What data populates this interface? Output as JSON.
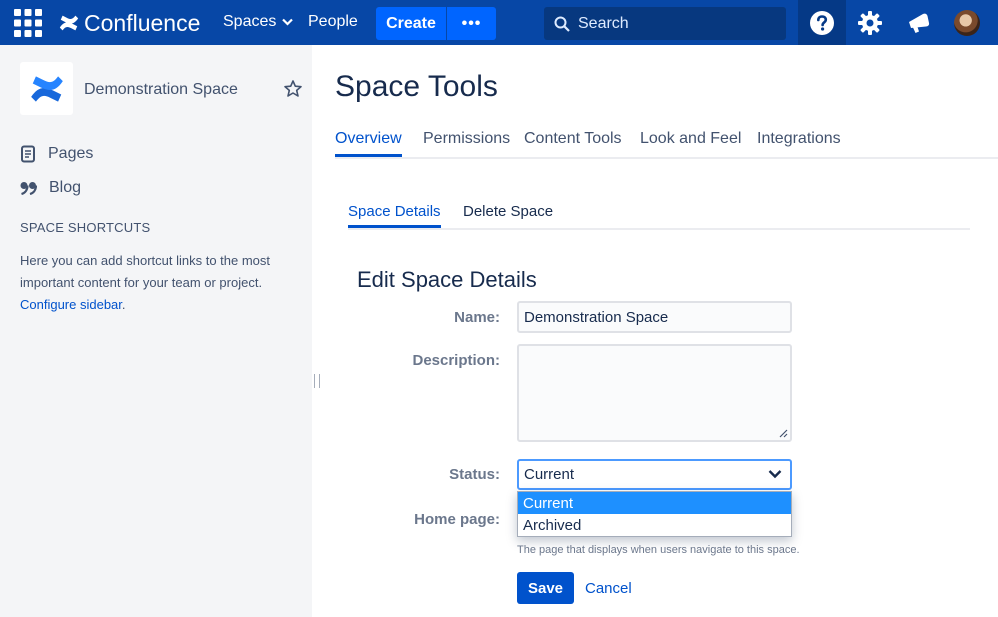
{
  "topnav": {
    "logo_text": "Confluence",
    "spaces_label": "Spaces",
    "people_label": "People",
    "create_label": "Create",
    "more_label": "•••",
    "search_placeholder": "Search"
  },
  "sidebar": {
    "space_name": "Demonstration Space",
    "items": [
      {
        "label": "Pages",
        "icon": "page-icon"
      },
      {
        "label": "Blog",
        "icon": "quote-icon"
      }
    ],
    "shortcuts_heading": "SPACE SHORTCUTS",
    "shortcuts_text": "Here you can add shortcut links to the most important content for your team or project.",
    "configure_link": "Configure sidebar",
    "configure_suffix": "."
  },
  "main": {
    "title": "Space Tools",
    "tabs": [
      {
        "label": "Overview",
        "active": true
      },
      {
        "label": "Permissions"
      },
      {
        "label": "Content Tools"
      },
      {
        "label": "Look and Feel"
      },
      {
        "label": "Integrations"
      }
    ],
    "subtabs": [
      {
        "label": "Space Details",
        "active": true
      },
      {
        "label": "Delete Space"
      }
    ],
    "form": {
      "heading": "Edit Space Details",
      "name_label": "Name:",
      "name_value": "Demonstration Space",
      "description_label": "Description:",
      "description_value": "",
      "status_label": "Status:",
      "status_value": "Current",
      "status_options": [
        "Current",
        "Archived"
      ],
      "homepage_label": "Home page:",
      "homepage_help": "The page that displays when users navigate to this space.",
      "save_label": "Save",
      "cancel_label": "Cancel"
    }
  },
  "colors": {
    "nav_bg": "#0747a6",
    "create_bg": "#0065ff",
    "link": "#0052cc",
    "dropdown_highlight": "#1e90ff"
  }
}
